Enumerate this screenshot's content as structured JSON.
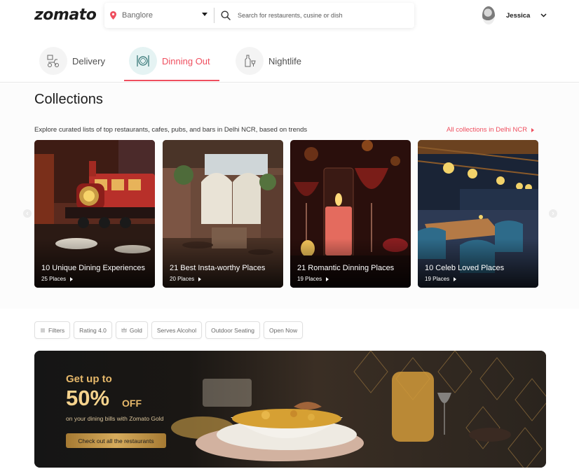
{
  "header": {
    "logo": "zomato",
    "location": "Banglore",
    "search_placeholder": "Search for restaurents, cusine or dish",
    "user_name": "Jessica"
  },
  "tabs": [
    {
      "label": "Delivery",
      "icon": "delivery-scooter-icon",
      "active": false
    },
    {
      "label": "Dinning Out",
      "icon": "dining-plate-icon",
      "active": true
    },
    {
      "label": "Nightlife",
      "icon": "nightlife-bottle-icon",
      "active": false
    }
  ],
  "collections": {
    "title": "Collections",
    "subtitle": "Explore curated lists of top restaurants, cafes, pubs, and bars in Delhi NCR, based on trends",
    "all_link": "All collections in Delhi NCR",
    "cards": [
      {
        "title": "10 Unique Dining Experiences",
        "places": "25 Places"
      },
      {
        "title": "21 Best Insta-worthy Places",
        "places": "20 Places"
      },
      {
        "title": "21 Romantic Dinning Places",
        "places": "19 Places"
      },
      {
        "title": "10 Celeb Loved Places",
        "places": "19 Places"
      }
    ]
  },
  "filters": [
    "Filters",
    "Rating 4.0",
    "Gold",
    "Serves Alcohol",
    "Outdoor Seating",
    "Open Now"
  ],
  "banner": {
    "line1": "Get up to",
    "big": "50%",
    "off": "OFF",
    "sub": "on your dining bills with Zomato Gold",
    "button": "Check out all the restaurants"
  },
  "colors": {
    "brand": "#ef4f5f",
    "gold": "#e6b86a",
    "banner_bg": "#1b1b1b"
  }
}
